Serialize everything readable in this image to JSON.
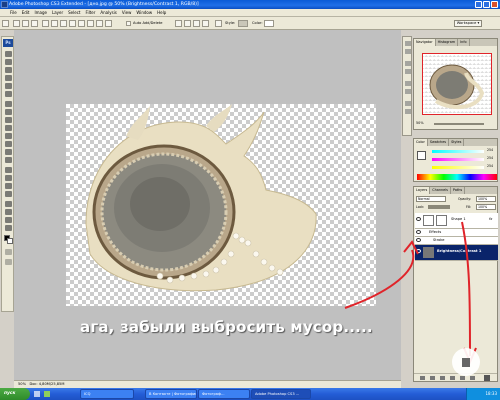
{
  "window": {
    "title": "Adobe Photoshop CS3 Extended - [дно.jpg @ 50% (Brightness/Contrast 1, RGB/8)]",
    "app_icon": "photoshop-icon"
  },
  "menu": [
    "File",
    "Edit",
    "Image",
    "Layer",
    "Select",
    "Filter",
    "Analysis",
    "View",
    "Window",
    "Help"
  ],
  "options": {
    "auto_add_delete": "Auto Add/Delete",
    "style_label": "Style:",
    "color_label": "Color:",
    "workspace": "Workspace ▾"
  },
  "toolbox": {
    "logo": "Ps"
  },
  "document": {
    "status": "Doc: 4,80M/25,85M",
    "zoom": "50%"
  },
  "navigator": {
    "tabs": [
      "Navigator",
      "Histogram",
      "Info"
    ],
    "zoom": "50%"
  },
  "color_panel": {
    "tabs": [
      "Color",
      "Swatches",
      "Styles"
    ],
    "r": "254",
    "g": "254",
    "b": "254"
  },
  "layers": {
    "tabs": [
      "Layers",
      "Channels",
      "Paths"
    ],
    "blend_mode": "Normal",
    "opacity_label": "Opacity:",
    "opacity": "100%",
    "lock_label": "Lock:",
    "fill_label": "Fill:",
    "fill": "100%",
    "rows": [
      {
        "name": "Shape 1",
        "fx": "fx"
      },
      {
        "name": "Effects"
      },
      {
        "name": "Stroke"
      },
      {
        "name": "Brightness/Contrast 1"
      }
    ]
  },
  "caption": "ага, забыли выбросить мусор.....",
  "taskbar": {
    "start": "пуск",
    "items": [
      "ICQ",
      "В Контакте | Фотографии",
      "Фотограф...",
      "Adobe Photoshop CS3 ..."
    ],
    "time": "18:33"
  },
  "colors": {
    "annotation_red": "#e0242a",
    "xp_blue": "#245dd6"
  }
}
